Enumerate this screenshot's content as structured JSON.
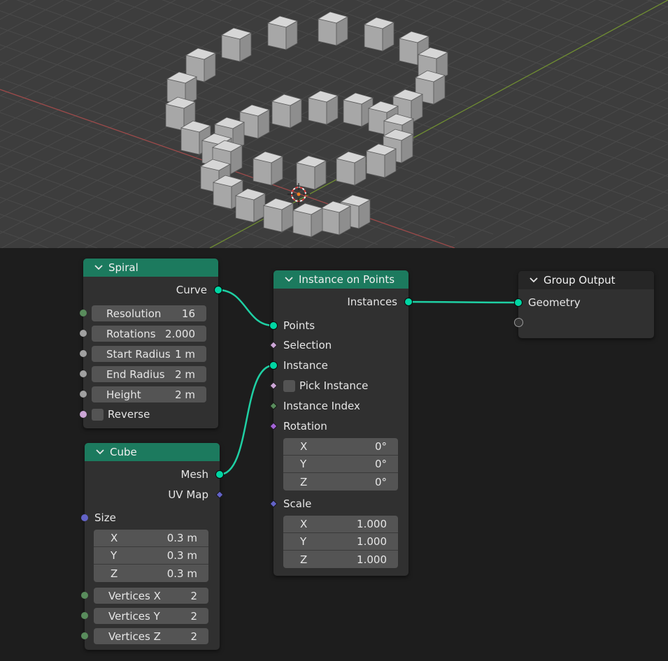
{
  "nodes": {
    "spiral": {
      "title": "Spiral",
      "output": "Curve",
      "fields": [
        {
          "label": "Resolution",
          "value": "16"
        },
        {
          "label": "Rotations",
          "value": "2.000"
        },
        {
          "label": "Start Radius",
          "value": "1 m"
        },
        {
          "label": "End Radius",
          "value": "2 m"
        },
        {
          "label": "Height",
          "value": "2 m"
        }
      ],
      "reverse_label": "Reverse"
    },
    "cube": {
      "title": "Cube",
      "outputs": [
        "Mesh",
        "UV Map"
      ],
      "size_label": "Size",
      "size": [
        {
          "axis": "X",
          "value": "0.3 m"
        },
        {
          "axis": "Y",
          "value": "0.3 m"
        },
        {
          "axis": "Z",
          "value": "0.3 m"
        }
      ],
      "vertices": [
        {
          "label": "Vertices X",
          "value": "2"
        },
        {
          "label": "Vertices Y",
          "value": "2"
        },
        {
          "label": "Vertices Z",
          "value": "2"
        }
      ]
    },
    "instance_on_points": {
      "title": "Instance on Points",
      "output": "Instances",
      "inputs": {
        "points": "Points",
        "selection": "Selection",
        "instance": "Instance",
        "pick_instance": "Pick Instance",
        "instance_index": "Instance Index",
        "rotation": "Rotation",
        "scale": "Scale"
      },
      "rotation": [
        {
          "axis": "X",
          "value": "0°"
        },
        {
          "axis": "Y",
          "value": "0°"
        },
        {
          "axis": "Z",
          "value": "0°"
        }
      ],
      "scale": [
        {
          "axis": "X",
          "value": "1.000"
        },
        {
          "axis": "Y",
          "value": "1.000"
        },
        {
          "axis": "Z",
          "value": "1.000"
        }
      ]
    },
    "group_output": {
      "title": "Group Output",
      "input": "Geometry"
    }
  },
  "colors": {
    "geometry_socket": "#00d6a3",
    "node_header_geometry": "#1c7a5e",
    "viewport_bg": "#3d3d3d",
    "editor_bg": "#1d1d1d"
  }
}
